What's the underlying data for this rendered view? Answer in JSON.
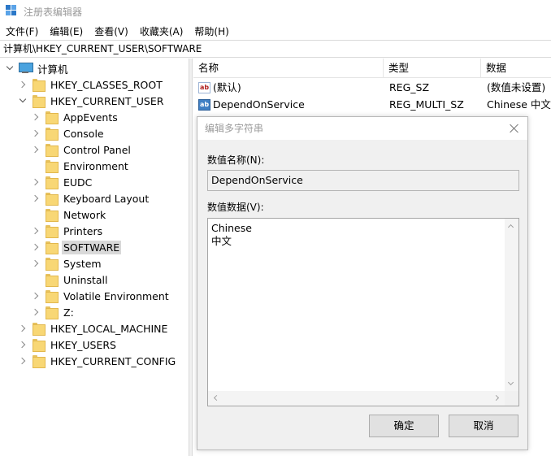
{
  "window": {
    "title": "注册表编辑器"
  },
  "menu": [
    "文件(F)",
    "编辑(E)",
    "查看(V)",
    "收藏夹(A)",
    "帮助(H)"
  ],
  "address": "计算机\\HKEY_CURRENT_USER\\SOFTWARE",
  "tree": {
    "root": "计算机",
    "items": [
      {
        "label": "HKEY_CLASSES_ROOT",
        "level": 1,
        "expanded": false
      },
      {
        "label": "HKEY_CURRENT_USER",
        "level": 1,
        "expanded": true
      },
      {
        "label": "AppEvents",
        "level": 2,
        "expanded": false
      },
      {
        "label": "Console",
        "level": 2,
        "expanded": false
      },
      {
        "label": "Control Panel",
        "level": 2,
        "expanded": false
      },
      {
        "label": "Environment",
        "level": 2,
        "expanded": null
      },
      {
        "label": "EUDC",
        "level": 2,
        "expanded": false
      },
      {
        "label": "Keyboard Layout",
        "level": 2,
        "expanded": false
      },
      {
        "label": "Network",
        "level": 2,
        "expanded": null
      },
      {
        "label": "Printers",
        "level": 2,
        "expanded": false
      },
      {
        "label": "SOFTWARE",
        "level": 2,
        "expanded": false,
        "selected": true
      },
      {
        "label": "System",
        "level": 2,
        "expanded": false
      },
      {
        "label": "Uninstall",
        "level": 2,
        "expanded": null
      },
      {
        "label": "Volatile Environment",
        "level": 2,
        "expanded": false
      },
      {
        "label": "Z:",
        "level": 2,
        "expanded": false
      },
      {
        "label": "HKEY_LOCAL_MACHINE",
        "level": 1,
        "expanded": false
      },
      {
        "label": "HKEY_USERS",
        "level": 1,
        "expanded": false
      },
      {
        "label": "HKEY_CURRENT_CONFIG",
        "level": 1,
        "expanded": false
      }
    ]
  },
  "list": {
    "columns": [
      "名称",
      "类型",
      "数据"
    ],
    "rows": [
      {
        "icon": "ab-string-icon",
        "name": "(默认)",
        "type": "REG_SZ",
        "data": "(数值未设置)"
      },
      {
        "icon": "ab-multi-string-icon",
        "name": "DependOnService",
        "type": "REG_MULTI_SZ",
        "data": "Chinese 中文"
      }
    ]
  },
  "dialog": {
    "title": "编辑多字符串",
    "name_label": "数值名称(N):",
    "name_value": "DependOnService",
    "data_label": "数值数据(V):",
    "data_value": "Chinese\n中文",
    "ok_label": "确定",
    "cancel_label": "取消"
  },
  "colors": {
    "selection": "#d9d9d9",
    "folder": "#f8d775",
    "dialog_bg": "#f0f0f0"
  }
}
